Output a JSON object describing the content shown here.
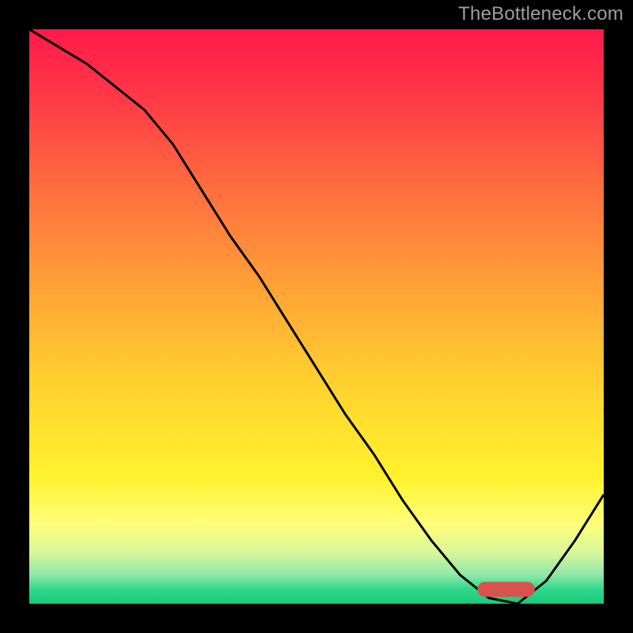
{
  "attribution": "TheBottleneck.com",
  "accent_color": "#d9524e",
  "chart_data": {
    "type": "line",
    "title": "",
    "xlabel": "",
    "ylabel": "",
    "xlim": [
      0,
      100
    ],
    "ylim": [
      0,
      100
    ],
    "grid": false,
    "legend": false,
    "background_gradient": {
      "stops": [
        {
          "offset": 0.0,
          "color": "#ff1a4a"
        },
        {
          "offset": 0.12,
          "color": "#ff3947"
        },
        {
          "offset": 0.28,
          "color": "#ff6e3f"
        },
        {
          "offset": 0.45,
          "color": "#ffa236"
        },
        {
          "offset": 0.62,
          "color": "#ffd22f"
        },
        {
          "offset": 0.78,
          "color": "#fff22d"
        },
        {
          "offset": 0.86,
          "color": "#fffe79"
        },
        {
          "offset": 0.91,
          "color": "#d8f79a"
        },
        {
          "offset": 0.95,
          "color": "#8fe8a8"
        },
        {
          "offset": 0.975,
          "color": "#2fd88a"
        },
        {
          "offset": 1.0,
          "color": "#18c97a"
        }
      ]
    },
    "series": [
      {
        "name": "bottleneck-curve",
        "color": "#000000",
        "x": [
          0,
          5,
          10,
          15,
          20,
          25,
          30,
          35,
          40,
          45,
          50,
          55,
          60,
          65,
          70,
          75,
          80,
          85,
          90,
          95,
          100
        ],
        "values": [
          100,
          97,
          94,
          90,
          86,
          80,
          72,
          64,
          57,
          49,
          41,
          33,
          26,
          18,
          11,
          5,
          1,
          0,
          4,
          11,
          19
        ]
      }
    ],
    "marker": {
      "name": "optimal-range",
      "color": "#d9524e",
      "x_start": 78,
      "x_end": 88,
      "y": 2.5,
      "thickness_pct": 2.6
    }
  }
}
